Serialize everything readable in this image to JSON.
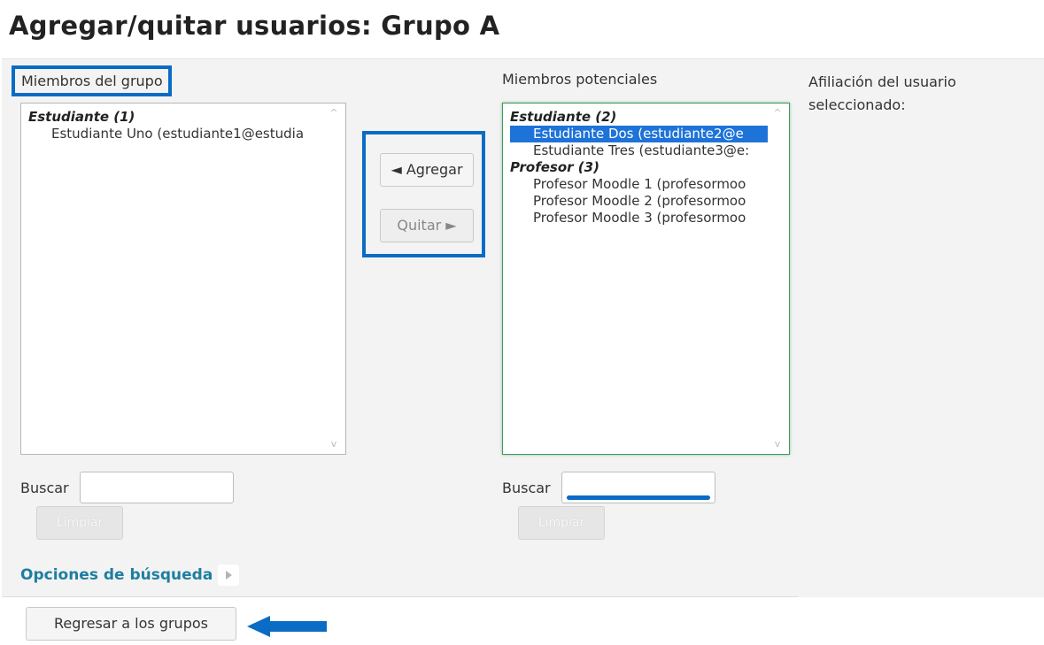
{
  "page": {
    "title": "Agregar/quitar usuarios: Grupo A"
  },
  "members": {
    "label": "Miembros del grupo",
    "groups": [
      {
        "label": "Estudiante (1)",
        "options": [
          "Estudiante Uno (estudiante1@estudia"
        ]
      }
    ],
    "search_label": "Buscar",
    "search_value": "",
    "clear_label": "Limpiar"
  },
  "actions": {
    "add_label": "◄ Agregar",
    "remove_label": "Quitar ►"
  },
  "potential": {
    "label": "Miembros potenciales",
    "groups": [
      {
        "label": "Estudiante (2)",
        "options": [
          "Estudiante Dos (estudiante2@e",
          "Estudiante Tres (estudiante3@e:"
        ]
      },
      {
        "label": "Profesor (3)",
        "options": [
          "Profesor Moodle 1 (profesormoo",
          "Profesor Moodle 2 (profesormoo",
          "Profesor Moodle 3 (profesormoo"
        ]
      }
    ],
    "selected_option": "Estudiante Dos (estudiante2@e",
    "search_label": "Buscar",
    "search_value": "",
    "clear_label": "Limpiar"
  },
  "affiliation": {
    "label": "Afiliación del usuario seleccionado:"
  },
  "search_options": {
    "label": "Opciones de búsqueda"
  },
  "footer": {
    "back_label": "Regresar a los grupos"
  },
  "colors": {
    "highlight": "#0a6cc4",
    "link": "#1e7ea0",
    "selection": "#1e73d8"
  }
}
